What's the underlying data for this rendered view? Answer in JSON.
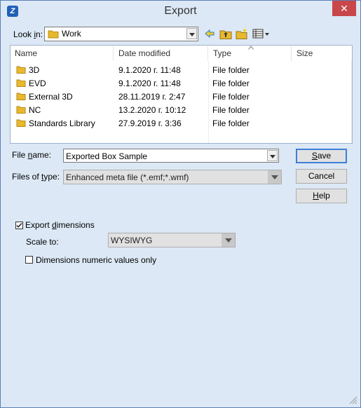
{
  "window": {
    "title": "Export",
    "close_glyph": "✕"
  },
  "look_in": {
    "label_pre": "Look ",
    "label_accel": "i",
    "label_post": "n:",
    "value": "Work"
  },
  "toolbar": {
    "icons": [
      "back-arrow-icon",
      "up-folder-icon",
      "new-folder-icon",
      "view-menu-icon"
    ]
  },
  "list": {
    "columns": [
      "Name",
      "Date modified",
      "Type",
      "Size"
    ],
    "rows": [
      {
        "name": "3D",
        "date": "9.1.2020 г. 11:48",
        "type": "File folder",
        "size": ""
      },
      {
        "name": "EVD",
        "date": "9.1.2020 г. 11:48",
        "type": "File folder",
        "size": ""
      },
      {
        "name": "External 3D",
        "date": "28.11.2019 г. 2:47",
        "type": "File folder",
        "size": ""
      },
      {
        "name": "NC",
        "date": "13.2.2020 г. 10:12",
        "type": "File folder",
        "size": ""
      },
      {
        "name": "Standards Library",
        "date": "27.9.2019 г. 3:36",
        "type": "File folder",
        "size": ""
      }
    ]
  },
  "file_name": {
    "label_pre": "File ",
    "label_accel": "n",
    "label_post": "ame:",
    "value": "Exported Box Sample"
  },
  "file_type": {
    "label_pre": "Files of ",
    "label_accel": "t",
    "label_post": "ype:",
    "value": "Enhanced meta file (*.emf;*.wmf)"
  },
  "buttons": {
    "save_accel": "S",
    "save_rest": "ave",
    "cancel": "Cancel",
    "help_accel": "H",
    "help_rest": "elp"
  },
  "options": {
    "export_dimensions": {
      "label_pre": "Export ",
      "label_accel": "d",
      "label_post": "imensions",
      "checked": true
    },
    "scale_to": {
      "label": "Scale to:",
      "value": "WYSIWYG"
    },
    "numeric_only": {
      "label": "Dimensions numeric values only",
      "checked": false
    }
  },
  "colors": {
    "accent": "#3c7fd8",
    "dialog_bg": "#dce8f5",
    "close": "#c7474a",
    "folder": "#e8b930"
  }
}
